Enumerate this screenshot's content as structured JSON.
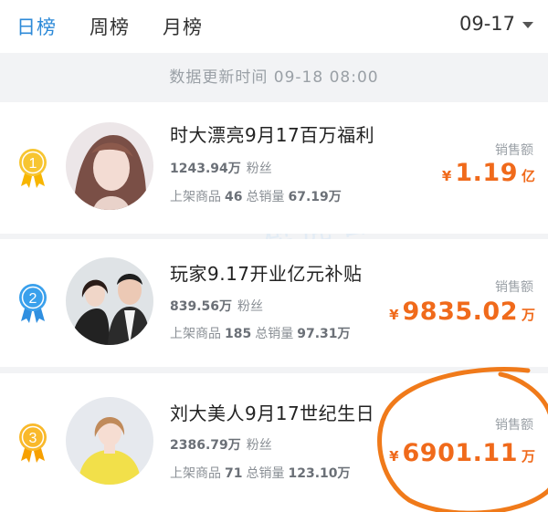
{
  "tabs": [
    {
      "label": "日榜",
      "active": true
    },
    {
      "label": "周榜",
      "active": false
    },
    {
      "label": "月榜",
      "active": false
    }
  ],
  "date_selector": "09-17",
  "update_text": "数据更新时间 09-18 08:00",
  "labels": {
    "fans_suffix": "粉丝",
    "goods_label": "上架商品",
    "total_sales_label": "总销量",
    "sales_amount_label": "销售额",
    "currency": "¥"
  },
  "entries": [
    {
      "rank": "1",
      "rank_color": "#f7b500",
      "name": "时大漂亮9月17百万福利",
      "fans": "1243.94万",
      "goods": "46",
      "total_sales": "67.19万",
      "amount": "1.19",
      "unit": "亿"
    },
    {
      "rank": "2",
      "rank_color": "#2f8fe0",
      "name": "玩家9.17开业亿元补贴",
      "fans": "839.56万",
      "goods": "185",
      "total_sales": "97.31万",
      "amount": "9835.02",
      "unit": "万"
    },
    {
      "rank": "3",
      "rank_color": "#f7a000",
      "name": "刘大美人9月17世纪生日",
      "fans": "2386.79万",
      "goods": "71",
      "total_sales": "123.10万",
      "amount": "6901.11",
      "unit": "万"
    }
  ],
  "watermark": "壁虎看看",
  "colors": {
    "accent": "#2d8ad8",
    "sales": "#f06a1b",
    "annotation": "#f07a1a"
  }
}
